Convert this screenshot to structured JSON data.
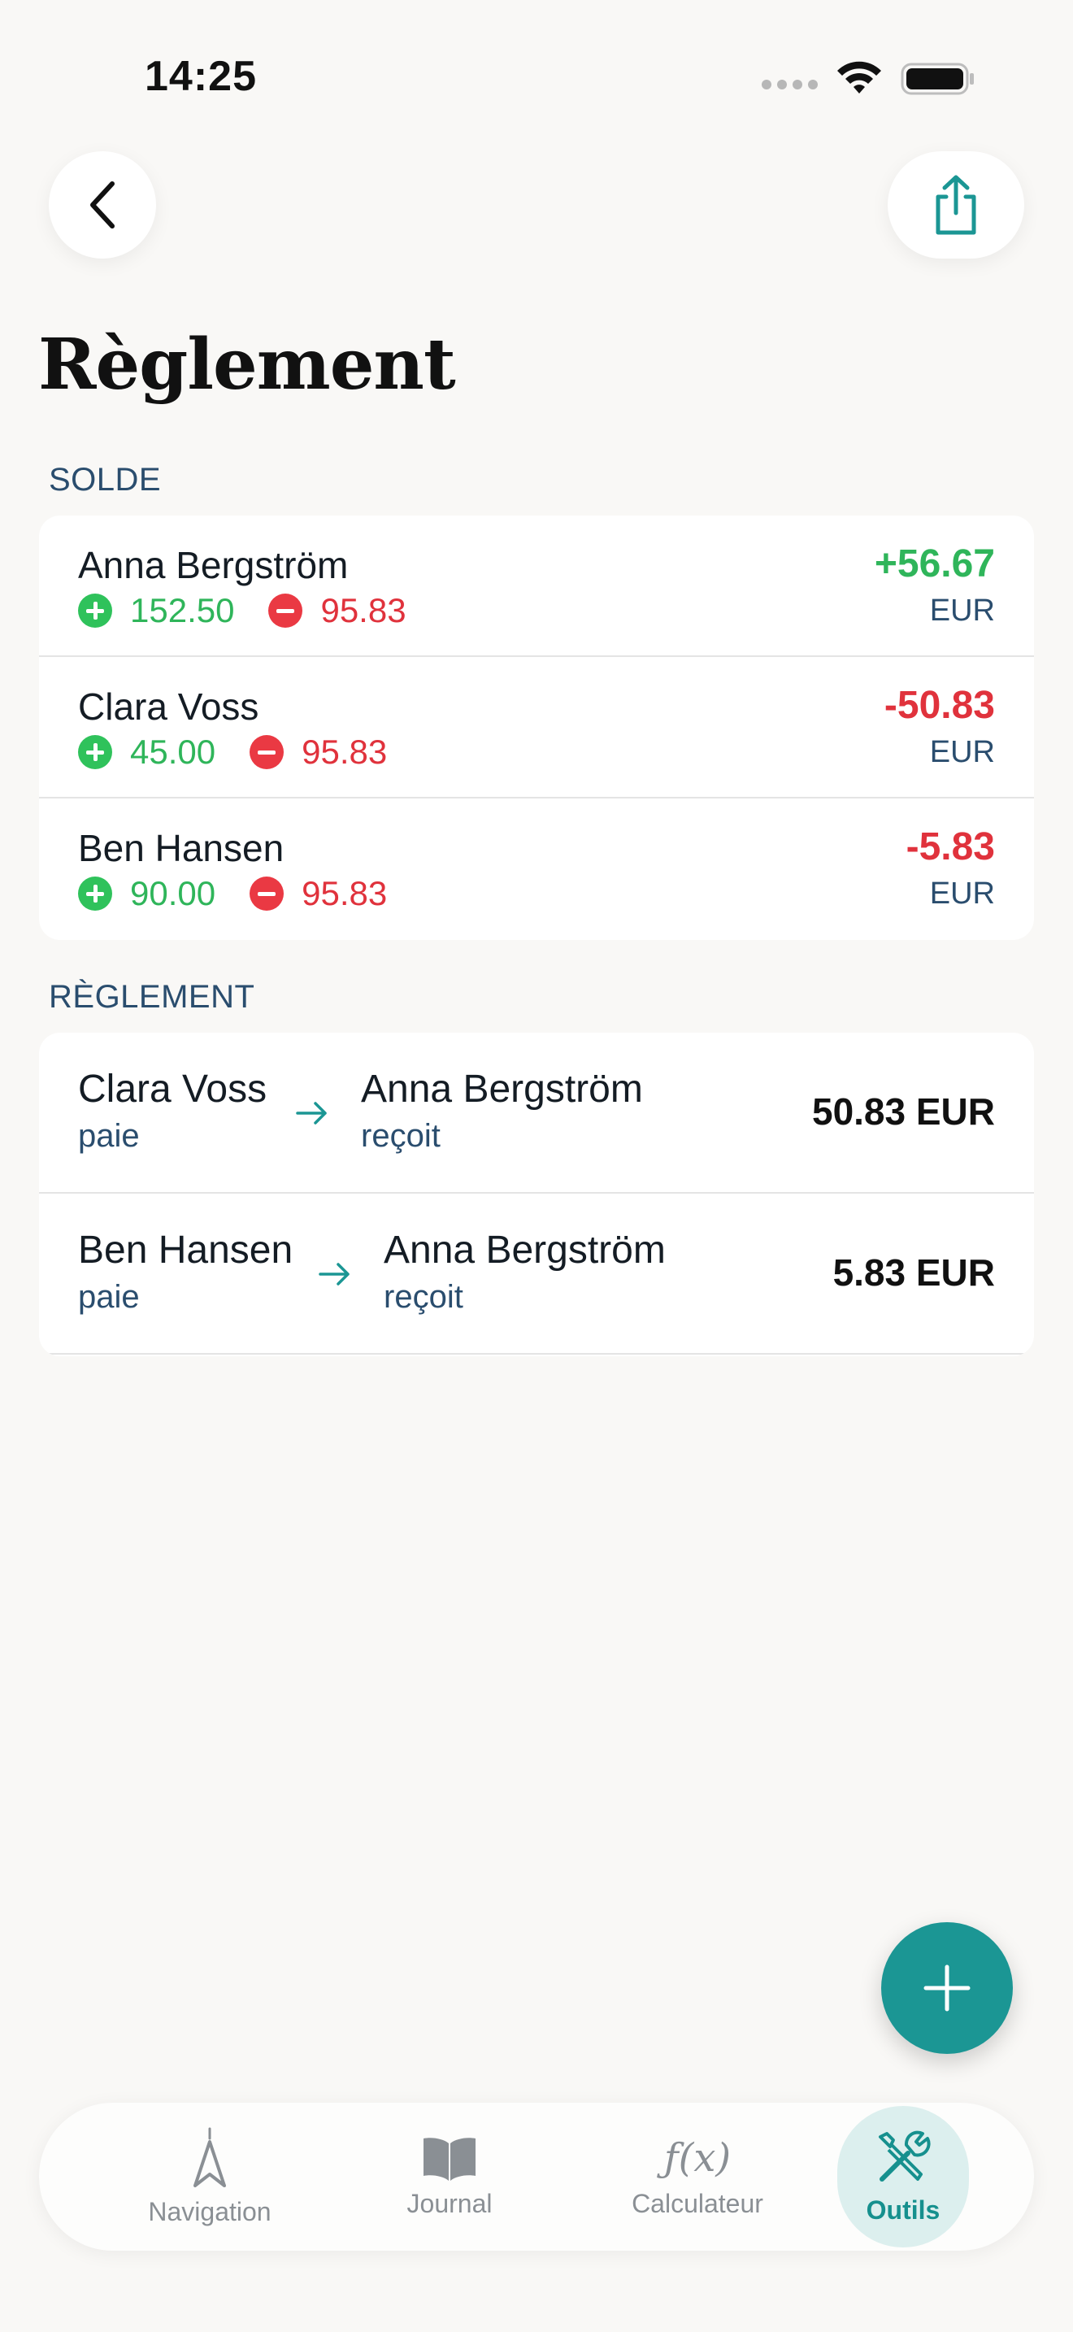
{
  "status_bar": {
    "time": "14:25"
  },
  "header": {
    "title": "Règlement"
  },
  "balance_section": {
    "label": "SOLDE",
    "rows": [
      {
        "name": "Anna Bergström",
        "credit": "152.50",
        "debit": "95.83",
        "balance": "+56.67",
        "currency": "EUR"
      },
      {
        "name": "Clara Voss",
        "credit": "45.00",
        "debit": "95.83",
        "balance": "-50.83",
        "currency": "EUR"
      },
      {
        "name": "Ben Hansen",
        "credit": "90.00",
        "debit": "95.83",
        "balance": "-5.83",
        "currency": "EUR"
      }
    ]
  },
  "settlement_section": {
    "label": "RÈGLEMENT",
    "rows": [
      {
        "from": "Clara Voss",
        "from_role": "paie",
        "to": "Anna Bergström",
        "to_role": "reçoit",
        "amount": "50.83 EUR"
      },
      {
        "from": "Ben Hansen",
        "from_role": "paie",
        "to": "Anna Bergström",
        "to_role": "reçoit",
        "amount": "5.83 EUR"
      }
    ]
  },
  "tabbar": {
    "items": [
      {
        "label": "Navigation",
        "icon": "navigation-icon"
      },
      {
        "label": "Journal",
        "icon": "book-icon"
      },
      {
        "label": "Calculateur",
        "icon": "function-icon"
      },
      {
        "label": "Outils",
        "icon": "tools-icon",
        "active": true
      }
    ]
  },
  "colors": {
    "accent": "#1b9694",
    "positive": "#2fb55a",
    "negative": "#e0323c",
    "label": "#2a4d6e"
  }
}
